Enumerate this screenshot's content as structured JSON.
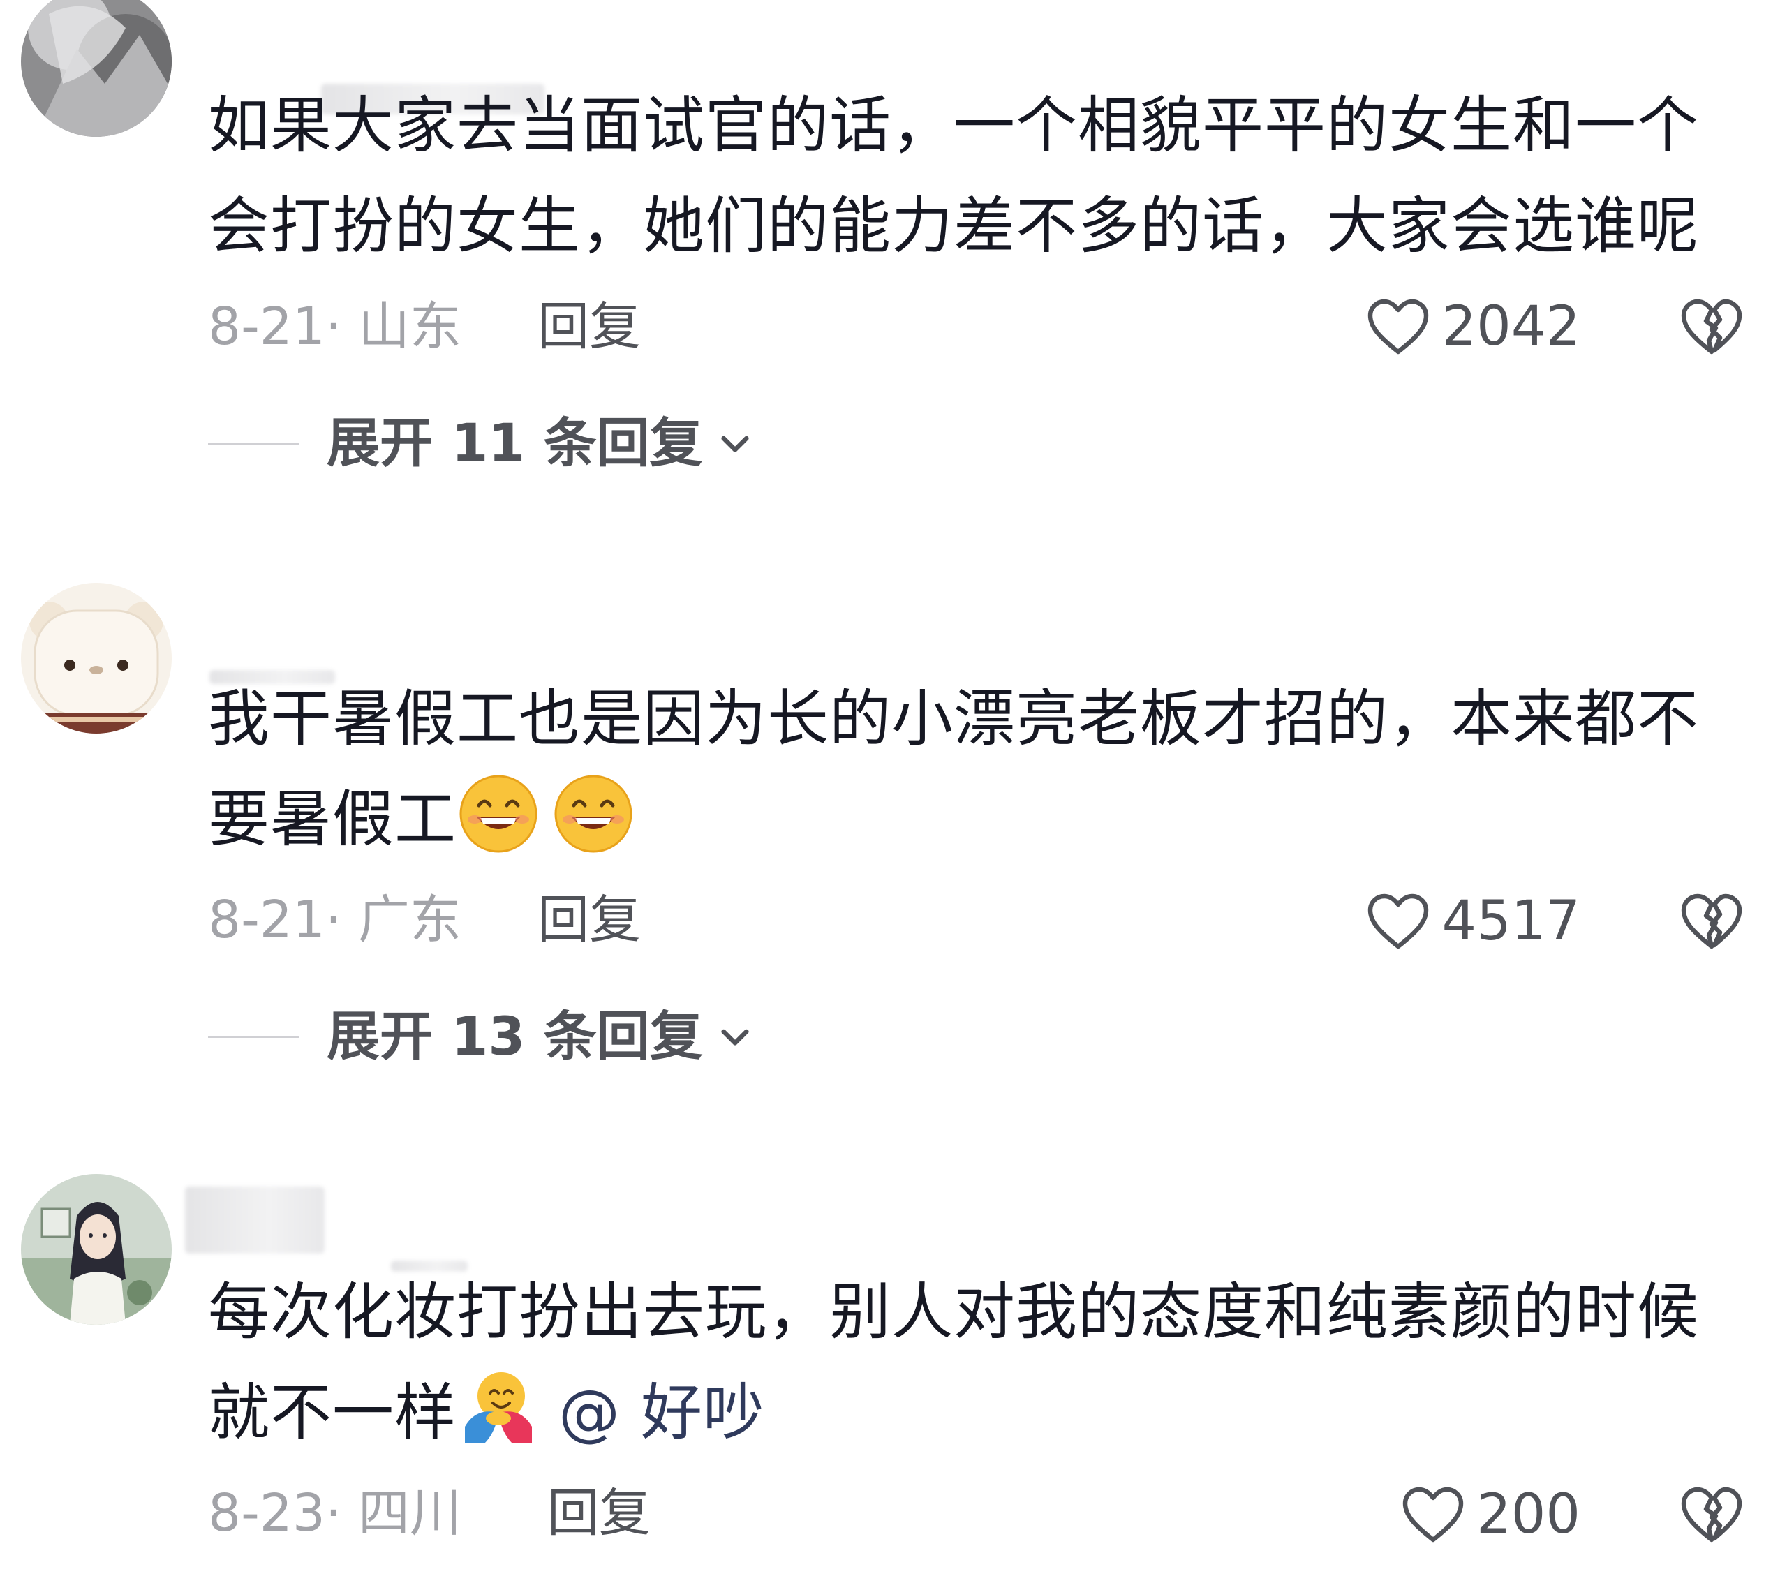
{
  "comments": [
    {
      "text": "如果大家去当面试官的话，一个相貌平平的女生和一个会打扮的女生，她们的能力差不多的话，大家会选谁呢",
      "date_location": "8-21· 山东",
      "reply_label": "回复",
      "likes": "2042",
      "expand_label": "展开 11 条回复"
    },
    {
      "text": "我干暑假工也是因为长的小漂亮老板才招的，本来都不要暑假工",
      "emojis": [
        "grin-emoji",
        "grin-emoji"
      ],
      "date_location": "8-21· 广东",
      "reply_label": "回复",
      "likes": "4517",
      "expand_label": "展开 13 条回复"
    },
    {
      "text": "每次化妆打扮出去玩，别人对我的态度和纯素颜的时候就不一样",
      "emojis": [
        "hug-emoji"
      ],
      "mention": "@ 好吵",
      "date_location": "8-23· 四川",
      "reply_label": "回复",
      "likes": "200"
    }
  ],
  "icons": {
    "like": "heart-outline-icon",
    "dislike": "broken-heart-icon",
    "expand": "chevron-down-icon"
  },
  "colors": {
    "text": "#161823",
    "meta": "#a2a3a8",
    "secondary": "#505258",
    "background": "#ffffff"
  }
}
